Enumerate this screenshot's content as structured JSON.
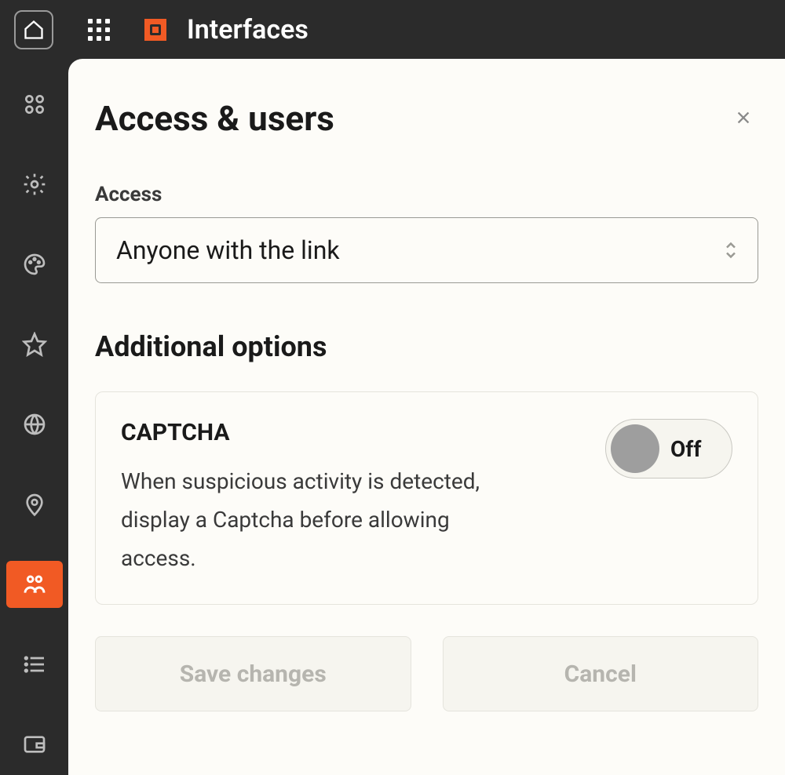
{
  "header": {
    "title": "Interfaces"
  },
  "panel": {
    "title": "Access & users",
    "access_label": "Access",
    "access_value": "Anyone with the link",
    "additional_heading": "Additional options",
    "captcha": {
      "title": "CAPTCHA",
      "description": "When suspicious activity is detected, display a Captcha before allowing access.",
      "toggle_state": "Off"
    },
    "buttons": {
      "save": "Save changes",
      "cancel": "Cancel"
    }
  },
  "sidebar": {
    "items": [
      {
        "name": "components-icon"
      },
      {
        "name": "settings-icon"
      },
      {
        "name": "palette-icon"
      },
      {
        "name": "star-icon"
      },
      {
        "name": "globe-icon"
      },
      {
        "name": "location-icon"
      },
      {
        "name": "users-icon",
        "active": true
      },
      {
        "name": "list-icon"
      },
      {
        "name": "wallet-icon"
      }
    ]
  }
}
